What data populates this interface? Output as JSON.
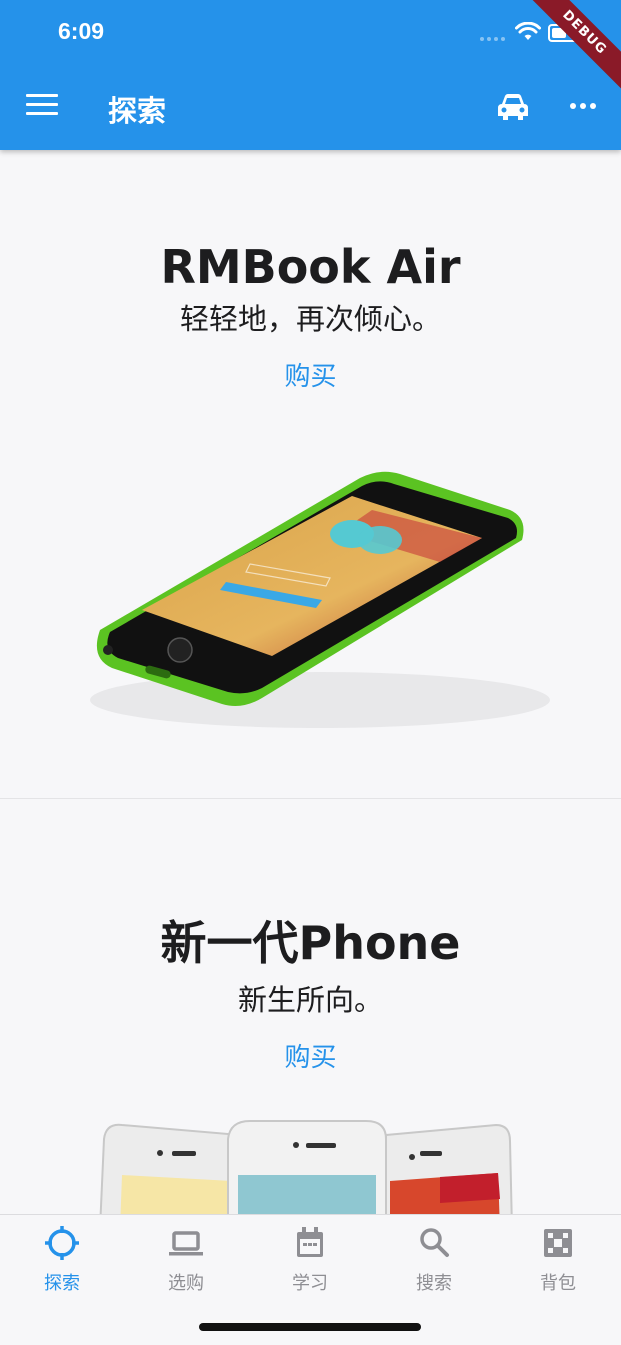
{
  "status": {
    "time": "6:09",
    "debug_label": "DEBUG"
  },
  "appbar": {
    "title": "探索"
  },
  "products": [
    {
      "title": "RMBook Air",
      "subtitle": "轻轻地，再次倾心。",
      "buy_label": "购买"
    },
    {
      "title": "新一代Phone",
      "subtitle": "新生所向。",
      "buy_label": "购买"
    }
  ],
  "tabs": [
    {
      "label": "探索",
      "icon": "explore-icon",
      "active": true
    },
    {
      "label": "选购",
      "icon": "laptop-icon",
      "active": false
    },
    {
      "label": "学习",
      "icon": "calendar-icon",
      "active": false
    },
    {
      "label": "搜索",
      "icon": "search-icon",
      "active": false
    },
    {
      "label": "背包",
      "icon": "bag-icon",
      "active": false
    }
  ],
  "colors": {
    "primary": "#2592ea",
    "inactive": "#8e8e93",
    "text": "#1d1d1f",
    "debug_banner": "#8a1a28"
  }
}
